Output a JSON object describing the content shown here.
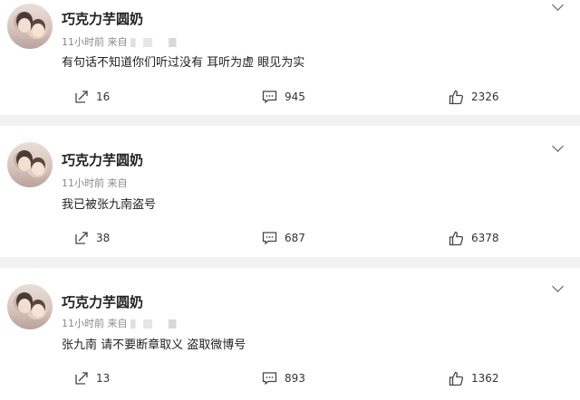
{
  "posts": [
    {
      "author": "巧克力芋圆奶",
      "time": "11小时前",
      "source_label": "来自",
      "source_name": "",
      "text": "有句话不知道你们听过没有 耳听为虚 眼见为实",
      "reposts": "16",
      "comments": "945",
      "likes": "2326"
    },
    {
      "author": "巧克力芋圆奶",
      "time": "11小时前",
      "source_label": "来自",
      "source_name": "",
      "text": "我已被张九南盗号",
      "reposts": "38",
      "comments": "687",
      "likes": "6378"
    },
    {
      "author": "巧克力芋圆奶",
      "time": "11小时前",
      "source_label": "来自",
      "source_name": "",
      "text": "张九南 请不要断章取义 盗取微博号",
      "reposts": "13",
      "comments": "893",
      "likes": "1362"
    }
  ],
  "icons": {
    "repost": "repost-icon",
    "comment": "comment-icon",
    "like": "thumbs-up-icon",
    "menu": "chevron-down-icon"
  },
  "colors": {
    "background": "#f2f2f2",
    "card": "#ffffff",
    "text": "#222222",
    "meta": "#8a8a8a"
  }
}
